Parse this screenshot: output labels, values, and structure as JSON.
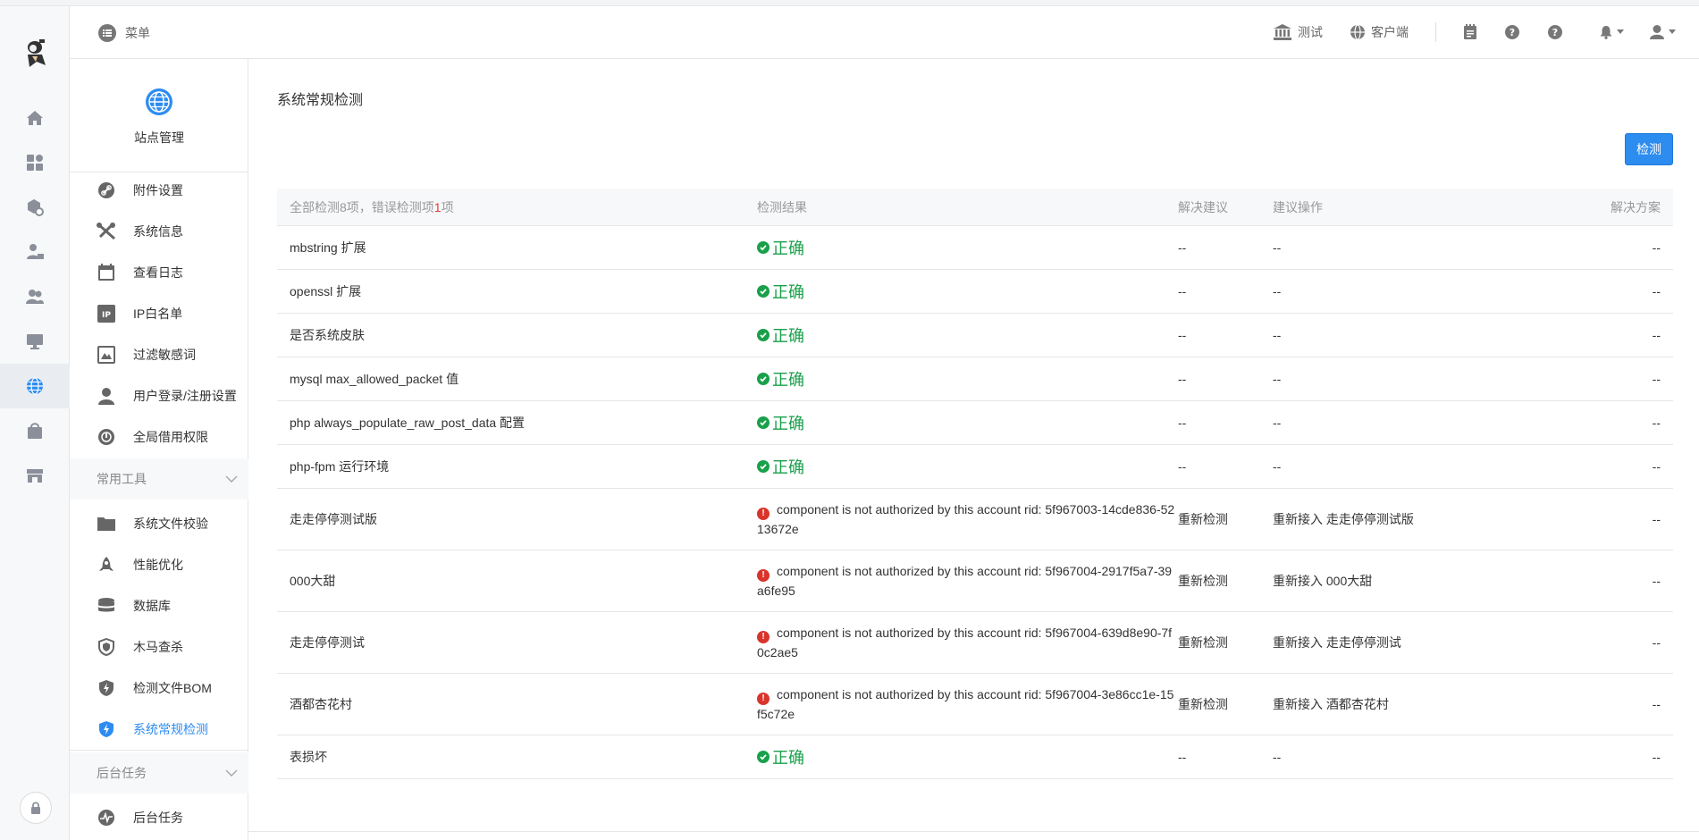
{
  "header": {
    "menu_label": "菜单",
    "test_label": "测试",
    "client_label": "客户端"
  },
  "sidebar": {
    "site_title": "站点管理",
    "items": [
      {
        "label": "附件设置",
        "icon": "link-icon"
      },
      {
        "label": "系统信息",
        "icon": "tools-icon"
      },
      {
        "label": "查看日志",
        "icon": "calendar-icon"
      },
      {
        "label": "IP白名单",
        "icon": "ip-icon"
      },
      {
        "label": "过滤敏感词",
        "icon": "filter-icon"
      },
      {
        "label": "用户登录/注册设置",
        "icon": "user-icon"
      },
      {
        "label": "全局借用权限",
        "icon": "permission-icon"
      }
    ],
    "group_tools": "常用工具",
    "tools": [
      {
        "label": "系统文件校验",
        "icon": "folder-icon"
      },
      {
        "label": "性能优化",
        "icon": "rocket-icon"
      },
      {
        "label": "数据库",
        "icon": "database-icon"
      },
      {
        "label": "木马查杀",
        "icon": "shield-icon"
      },
      {
        "label": "检测文件BOM",
        "icon": "shield-bolt-icon"
      },
      {
        "label": "系统常规检测",
        "icon": "shield-check-icon"
      }
    ],
    "group_tasks": "后台任务",
    "tasks": [
      {
        "label": "后台任务",
        "icon": "pulse-icon"
      }
    ]
  },
  "main": {
    "title": "系统常规检测",
    "check_button": "检测",
    "summary_prefix": "全部检测8项，错误检测项",
    "summary_count": "1",
    "summary_suffix": "项",
    "columns": {
      "result": "检测结果",
      "advice": "解决建议",
      "action": "建议操作",
      "solution": "解决方案"
    },
    "rows": [
      {
        "name": "mbstring 扩展",
        "status": "ok",
        "result": "正确",
        "advice": "--",
        "action": "--",
        "solution": "--"
      },
      {
        "name": "openssl 扩展",
        "status": "ok",
        "result": "正确",
        "advice": "--",
        "action": "--",
        "solution": "--"
      },
      {
        "name": "是否系统皮肤",
        "status": "ok",
        "result": "正确",
        "advice": "--",
        "action": "--",
        "solution": "--"
      },
      {
        "name": "mysql max_allowed_packet 值",
        "status": "ok",
        "result": "正确",
        "advice": "--",
        "action": "--",
        "solution": "--"
      },
      {
        "name": "php always_populate_raw_post_data 配置",
        "status": "ok",
        "result": "正确",
        "advice": "--",
        "action": "--",
        "solution": "--"
      },
      {
        "name": "php-fpm 运行环境",
        "status": "ok",
        "result": "正确",
        "advice": "--",
        "action": "--",
        "solution": "--"
      },
      {
        "name": "走走停停测试版",
        "status": "error",
        "result": "component is not authorized by this account rid: 5f967003-14cde836-5213672e",
        "advice": "重新检测",
        "action": "重新接入 走走停停测试版",
        "solution": "--"
      },
      {
        "name": "000大甜",
        "status": "error",
        "result": "component is not authorized by this account rid: 5f967004-2917f5a7-39a6fe95",
        "advice": "重新检测",
        "action": "重新接入 000大甜",
        "solution": "--"
      },
      {
        "name": "走走停停测试",
        "status": "error",
        "result": "component is not authorized by this account rid: 5f967004-639d8e90-7f0c2ae5",
        "advice": "重新检测",
        "action": "重新接入 走走停停测试",
        "solution": "--"
      },
      {
        "name": "酒都杏花村",
        "status": "error",
        "result": "component is not authorized by this account rid: 5f967004-3e86cc1e-15f5c72e",
        "advice": "重新检测",
        "action": "重新接入 酒都杏花村",
        "solution": "--"
      },
      {
        "name": "表损坏",
        "status": "ok",
        "result": "正确",
        "advice": "--",
        "action": "--",
        "solution": "--"
      }
    ]
  },
  "colors": {
    "accent": "#2d8cf0",
    "ok": "#19a04a",
    "error": "#d9342b"
  }
}
